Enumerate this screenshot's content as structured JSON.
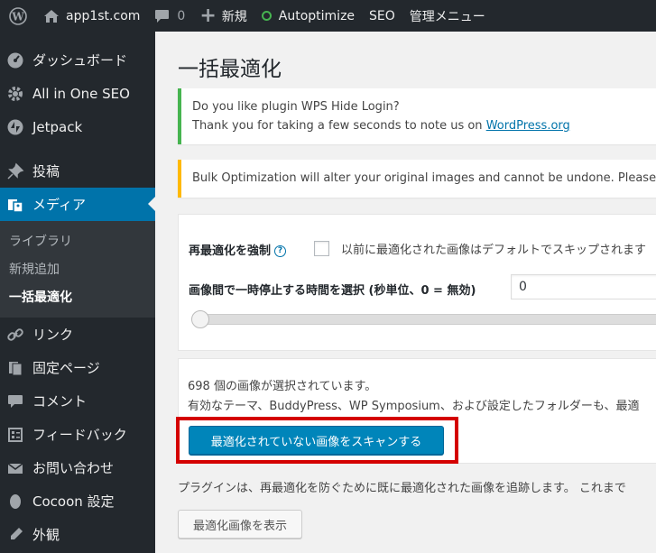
{
  "admin_bar": {
    "site_name": "app1st.com",
    "comments_count": "0",
    "new_label": "新規",
    "autoptimize_label": "Autoptimize",
    "seo_label": "SEO",
    "admin_menu_label": "管理メニュー",
    "status_color": "#46b450"
  },
  "sidebar": {
    "items": [
      {
        "label": "ダッシュボード",
        "icon": "dashboard-icon"
      },
      {
        "label": "All in One SEO",
        "icon": "gear-icon"
      },
      {
        "label": "Jetpack",
        "icon": "jetpack-icon"
      },
      {
        "label": "投稿",
        "icon": "pin-icon"
      },
      {
        "label": "メディア",
        "icon": "media-icon"
      },
      {
        "label": "リンク",
        "icon": "link-icon"
      },
      {
        "label": "固定ページ",
        "icon": "page-icon"
      },
      {
        "label": "コメント",
        "icon": "comment-icon"
      },
      {
        "label": "フィードバック",
        "icon": "feedback-icon"
      },
      {
        "label": "お問い合わせ",
        "icon": "mail-icon"
      },
      {
        "label": "Cocoon 設定",
        "icon": "cocoon-icon"
      },
      {
        "label": "外観",
        "icon": "appearance-icon"
      }
    ],
    "media_submenu": [
      {
        "label": "ライブラリ"
      },
      {
        "label": "新規追加"
      },
      {
        "label": "一括最適化"
      }
    ],
    "active_color": "#0073aa"
  },
  "page": {
    "title": "一括最適化"
  },
  "notice_success": {
    "line1": "Do you like plugin WPS Hide Login?",
    "line2_prefix": "Thank you for taking a few seconds to note us on ",
    "link_text": "WordPress.org"
  },
  "notice_warning": {
    "text": "Bulk Optimization will alter your original images and cannot be undone. Please be sure"
  },
  "settings": {
    "force_label": "再最適化を強制",
    "force_desc": "以前に最適化された画像はデフォルトでスキップされます",
    "delay_label": "画像間で一時停止する時間を選択 (秒単位、0 = 無効)",
    "delay_value": "0",
    "slider_value": 0
  },
  "scan": {
    "count_text": "698 個の画像が選択されています。",
    "desc_text": "有効なテーマ、BuddyPress、WP Symposium、および設定したフォルダーも、最適",
    "scan_button": "最適化されていない画像をスキャンする",
    "highlight_color": "#d40000"
  },
  "footer": {
    "tracking_text": "プラグインは、再最適化を防ぐために既に最適化された画像を追跡します。 これまで",
    "show_button": "最適化画像を表示"
  }
}
